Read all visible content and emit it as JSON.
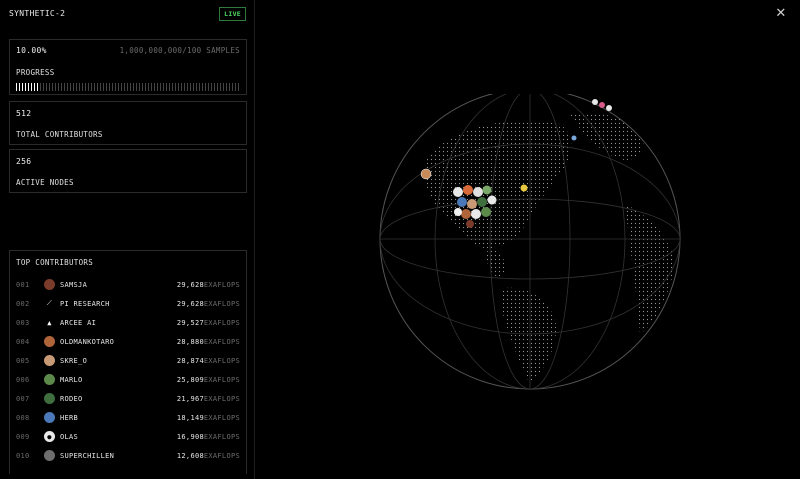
{
  "header": {
    "title": "SYNTHETIC-2",
    "badge": "LIVE"
  },
  "progress": {
    "percent_label": "10.00%",
    "samples_label": "1,000,000,000/100 SAMPLES",
    "label": "PROGRESS",
    "fraction": 0.1
  },
  "stats": {
    "contributors": {
      "value": "512",
      "label": "TOTAL CONTRIBUTORS"
    },
    "nodes": {
      "value": "256",
      "label": "ACTIVE NODES"
    }
  },
  "top_contributors": {
    "title": "TOP CONTRIBUTORS",
    "unit": "EXAFLOPS",
    "rows": [
      {
        "rank": "001",
        "name": "SAMSJA",
        "value": "29,628",
        "icon": "avatar-person",
        "color": "#7a3b2a"
      },
      {
        "rank": "002",
        "name": "PI RESEARCH",
        "value": "29,628",
        "icon": "pi-logo",
        "color": "#000000"
      },
      {
        "rank": "003",
        "name": "ARCEE AI",
        "value": "29,527",
        "icon": "arcee-logo",
        "color": "#000000"
      },
      {
        "rank": "004",
        "name": "OLDMANKOTARO",
        "value": "28,880",
        "icon": "avatar-person",
        "color": "#b0643a"
      },
      {
        "rank": "005",
        "name": "SKRE_O",
        "value": "28,874",
        "icon": "avatar-person",
        "color": "#c99a76"
      },
      {
        "rank": "006",
        "name": "MARLO",
        "value": "25,809",
        "icon": "avatar-person",
        "color": "#5c8a4a"
      },
      {
        "rank": "007",
        "name": "RODEO",
        "value": "21,967",
        "icon": "avatar-person",
        "color": "#3f6e3f"
      },
      {
        "rank": "008",
        "name": "HERB",
        "value": "18,149",
        "icon": "avatar-person",
        "color": "#4a78b8"
      },
      {
        "rank": "009",
        "name": "OLAS",
        "value": "16,908",
        "icon": "olas-logo",
        "color": "#e8e8e8"
      },
      {
        "rank": "010",
        "name": "SUPERCHILLEN",
        "value": "12,608",
        "icon": "avatar-person",
        "color": "#6e6e6e"
      }
    ]
  },
  "icons": {
    "close": "close-icon",
    "globe": "globe-map"
  }
}
